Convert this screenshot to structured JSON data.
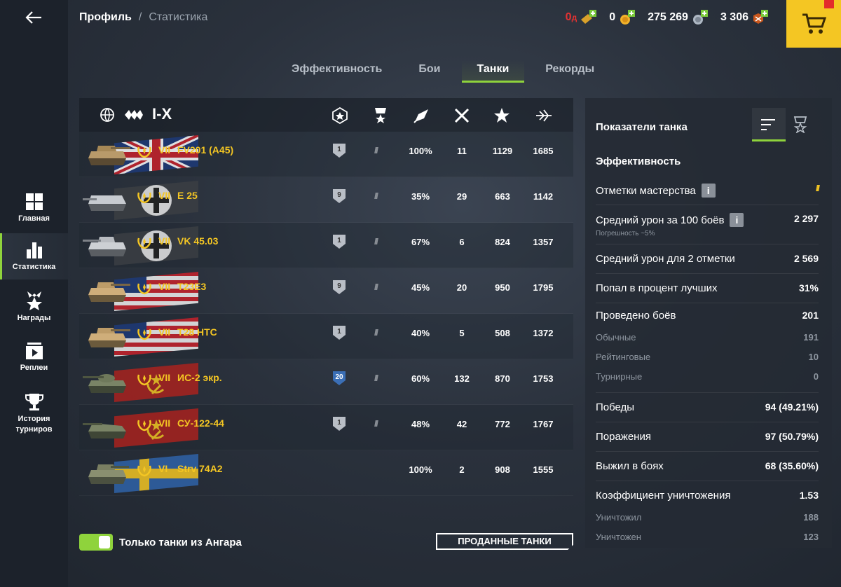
{
  "breadcrumb": {
    "root": "Профиль",
    "separator": "/",
    "current": "Статистика"
  },
  "currencies": {
    "gold_alt": "0",
    "gold_alt_suffix": "д",
    "gold": "0",
    "credits": "275 269",
    "free_xp": "3 306"
  },
  "sidebar": {
    "items": [
      {
        "label": "Главная",
        "icon": "home-grid-icon"
      },
      {
        "label": "Статистика",
        "icon": "bar-chart-icon"
      },
      {
        "label": "Награды",
        "icon": "star-award-icon"
      },
      {
        "label": "Реплеи",
        "icon": "play-icon"
      },
      {
        "label": "История турниров",
        "icon": "trophy-icon"
      }
    ]
  },
  "tabs": [
    "Эффективность",
    "Бои",
    "Танки",
    "Рекорды"
  ],
  "active_tab": "Танки",
  "filter": {
    "tier": "I-X"
  },
  "tanks": [
    {
      "tier": "VII",
      "name": "FV201 (A45)",
      "mastery": "1",
      "winrate": "100%",
      "battles": "11",
      "avg_damage": "1129",
      "avg_xp": "1685",
      "nation": "uk"
    },
    {
      "tier": "VII",
      "name": "E 25",
      "mastery": "9",
      "winrate": "35%",
      "battles": "29",
      "avg_damage": "663",
      "avg_xp": "1142",
      "nation": "germany"
    },
    {
      "tier": "VII",
      "name": "VK 45.03",
      "mastery": "1",
      "winrate": "67%",
      "battles": "6",
      "avg_damage": "824",
      "avg_xp": "1357",
      "nation": "germany"
    },
    {
      "tier": "VII",
      "name": "T23E3",
      "mastery": "9",
      "winrate": "45%",
      "battles": "20",
      "avg_damage": "950",
      "avg_xp": "1795",
      "nation": "usa"
    },
    {
      "tier": "VII",
      "name": "T28 HTC",
      "mastery": "1",
      "winrate": "40%",
      "battles": "5",
      "avg_damage": "508",
      "avg_xp": "1372",
      "nation": "usa"
    },
    {
      "tier": "VII",
      "name": "ИС-2 экр.",
      "mastery": "20",
      "winrate": "60%",
      "battles": "132",
      "avg_damage": "870",
      "avg_xp": "1753",
      "nation": "ussr"
    },
    {
      "tier": "VII",
      "name": "СУ-122-44",
      "mastery": "1",
      "winrate": "48%",
      "battles": "42",
      "avg_damage": "772",
      "avg_xp": "1767",
      "nation": "ussr"
    },
    {
      "tier": "VI",
      "name": "Strv 74A2",
      "mastery": "",
      "winrate": "100%",
      "battles": "2",
      "avg_damage": "908",
      "avg_xp": "1555",
      "nation": "sweden"
    }
  ],
  "bottom": {
    "toggle_label": "Только танки из Ангара",
    "sold_button": "ПРОДАННЫЕ ТАНКИ"
  },
  "panel": {
    "title": "Показатели танка",
    "section": "Эффективность",
    "mastery_marks_label": "Отметки мастерства",
    "avg_damage_100_label": "Средний урон за 100 боёв",
    "avg_damage_100_value": "2 297",
    "avg_damage_100_note": "Погрешность ~5%",
    "avg_damage_marks_label": "Средний урон для 2 отметки",
    "avg_damage_marks_value": "2 569",
    "top_percent_label": "Попал в процент лучших",
    "top_percent_value": "31%",
    "battles_label": "Проведено боёв",
    "battles_value": "201",
    "regular_label": "Обычные",
    "regular_value": "191",
    "rating_label": "Рейтинговые",
    "rating_value": "10",
    "tournament_label": "Турнирные",
    "tournament_value": "0",
    "wins_label": "Победы",
    "wins_value": "94 (49.21%)",
    "losses_label": "Поражения",
    "losses_value": "97 (50.79%)",
    "survived_label": "Выжил в боях",
    "survived_value": "68 (35.60%)",
    "kd_label": "Коэффициент уничтожения",
    "kd_value": "1.53",
    "destroyed_label": "Уничтожил",
    "destroyed_value": "188",
    "killed_label": "Уничтожен",
    "killed_value": "123"
  },
  "colors": {
    "accent": "#8fd33c",
    "premium": "#f4c623",
    "gold_red": "#e63232"
  }
}
